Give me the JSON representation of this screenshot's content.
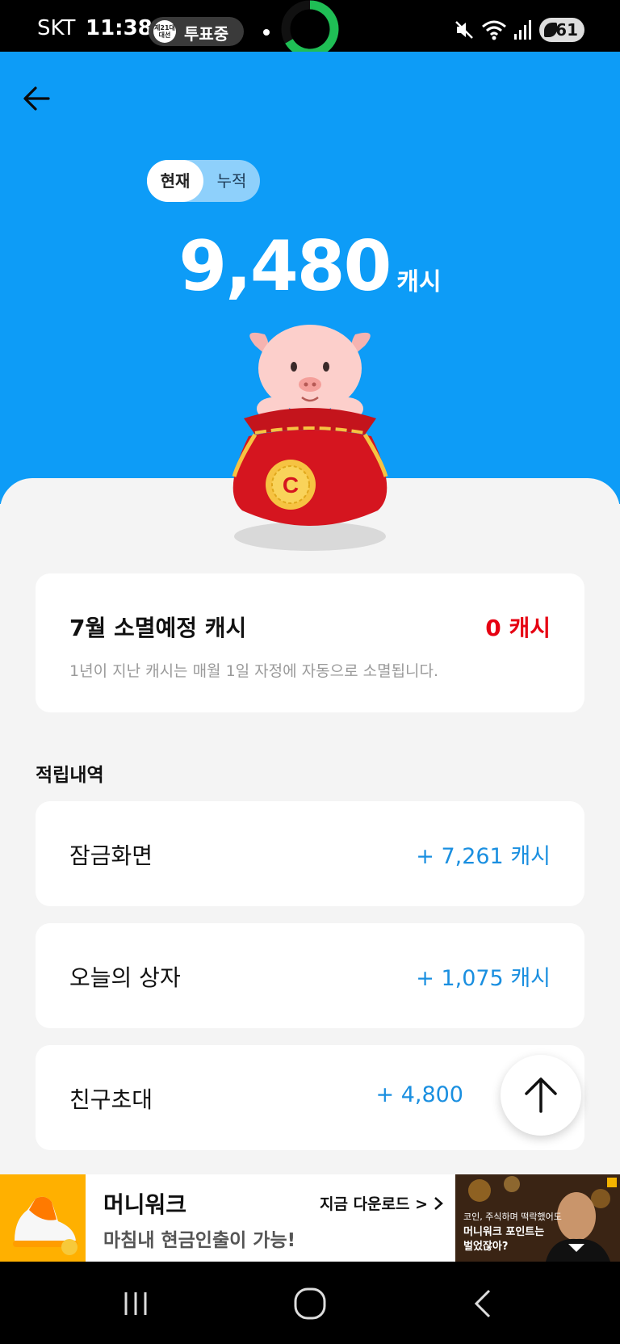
{
  "status_bar": {
    "carrier": "SKT",
    "time": "11:38",
    "pill_icon_text": "제21대 대선",
    "pill_text": "투표중",
    "battery": "61"
  },
  "header": {
    "toggle_current": "현재",
    "toggle_total": "누적"
  },
  "balance": {
    "value": "9,480",
    "unit": "캐시"
  },
  "expire_card": {
    "title": "7월 소멸예정 캐시",
    "value": "0 캐시",
    "description": "1년이 지난 캐시는 매월 1일 자정에 자동으로 소멸됩니다."
  },
  "history": {
    "section_title": "적립내역",
    "rows": [
      {
        "label": "잠금화면",
        "value": "+ 7,261 캐시"
      },
      {
        "label": "오늘의 상자",
        "value": "+ 1,075 캐시"
      },
      {
        "label": "친구초대",
        "value": "+ 4,800"
      }
    ]
  },
  "ad": {
    "title": "머니워크",
    "subtitle": "마침내 현금인출이 가능!",
    "cta": "지금 다운로드 > ",
    "image_lines": [
      "코인, 주식하며 떡락했어도",
      "머니워크 포인트는",
      "벌었잖아?"
    ]
  },
  "colors": {
    "hero_blue": "#0d9cf7",
    "expire_red": "#e60012",
    "history_blue": "#1a8fe0"
  }
}
